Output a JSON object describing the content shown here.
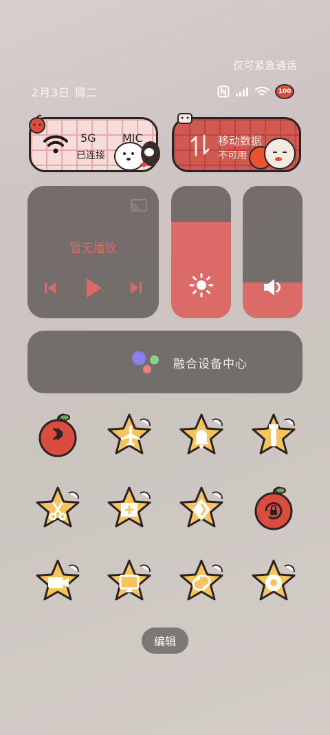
{
  "status": {
    "emergency_text": "仅可紧急通话",
    "date_text": "2月3日 周二",
    "battery_text": "100"
  },
  "tiles": {
    "wifi": {
      "title": "5G",
      "subtitle": "已连接",
      "extra": "MIC"
    },
    "mobile_data": {
      "title": "移动数据",
      "subtitle": "不可用"
    }
  },
  "media": {
    "label": "暂无播放"
  },
  "sliders": {
    "brightness_level": 0.73,
    "volume_level": 0.27
  },
  "device_center": {
    "label": "融合设备中心"
  },
  "toggles": [
    {
      "name": "bluetooth",
      "icon": "bluetooth-icon",
      "active": true
    },
    {
      "name": "airplane-mode",
      "icon": "airplane-icon",
      "active": false
    },
    {
      "name": "do-not-disturb",
      "icon": "bell-icon",
      "active": false
    },
    {
      "name": "flashlight",
      "icon": "flashlight-icon",
      "active": false
    },
    {
      "name": "screenshot",
      "icon": "scissors-icon",
      "active": false
    },
    {
      "name": "calculator",
      "icon": "calculator-icon",
      "active": false
    },
    {
      "name": "nfc-wallet",
      "icon": "diamond-icon",
      "active": false
    },
    {
      "name": "rotation-lock",
      "icon": "rotation-lock-icon",
      "active": true
    },
    {
      "name": "screen-record",
      "icon": "video-icon",
      "active": false
    },
    {
      "name": "projection",
      "icon": "projection-icon",
      "active": false
    },
    {
      "name": "share",
      "icon": "link-icon",
      "active": false
    },
    {
      "name": "settings",
      "icon": "gear-icon",
      "active": false
    }
  ],
  "edit_button": {
    "label": "编辑"
  },
  "colors": {
    "accent": "#dc6b67",
    "star": "#f5c45c",
    "apple": "#d94c3f",
    "panel": "#645e5c"
  }
}
